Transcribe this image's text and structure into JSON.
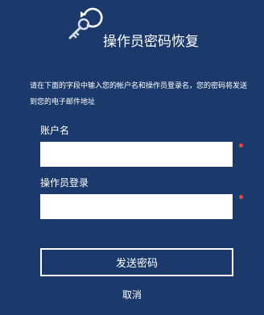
{
  "header": {
    "icon": "key-reset-icon",
    "title": "操作员密码恢复"
  },
  "form": {
    "description": "请在下面的字段中输入您的帐户名和操作员登录名，您的密码将发送到您的电子邮件地址",
    "account_label": "账户名",
    "account_value": "",
    "operator_label": "操作员登录",
    "operator_value": "",
    "required_color": "#e04a3f"
  },
  "actions": {
    "send_label": "发送密码",
    "cancel_label": "取消"
  },
  "colors": {
    "background": "#1b3a6b",
    "text": "#ffffff"
  }
}
